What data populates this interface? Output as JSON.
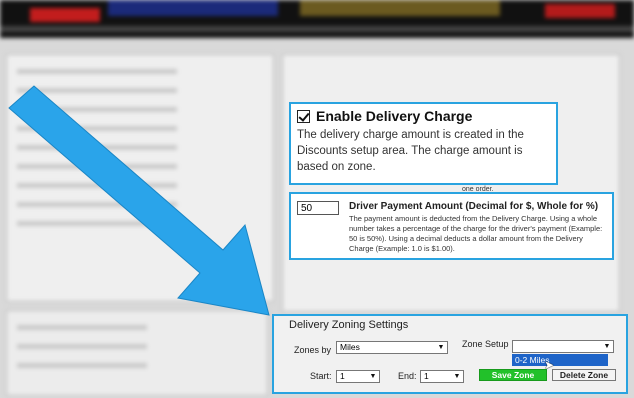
{
  "enable_callout": {
    "title": "Enable Delivery Charge",
    "description": "The delivery charge amount is created in the Discounts setup area. The charge amount is based on zone."
  },
  "driver_callout": {
    "value": "50",
    "label": "Driver Payment Amount (Decimal for $, Whole for %)",
    "description": "The payment amount is deducted from the Delivery Charge. Using a whole number takes a percentage of the charge for the driver's payment (Example: 50 is 50%). Using a decimal deducts a dollar amount from the Delivery Charge (Example: 1.0 is $1.00)."
  },
  "zoning": {
    "title": "Delivery Zoning Settings",
    "zones_by_label": "Zones by",
    "zones_by_value": "Miles",
    "zone_setup_label": "Zone Setup",
    "zone_setup_value": "",
    "zone_setup_option": "0-2 Miles",
    "start_label": "Start:",
    "start_value": "1",
    "end_label": "End:",
    "end_value": "1",
    "save_label": "Save Zone",
    "delete_label": "Delete Zone"
  },
  "background": {
    "tail_text": "one order."
  },
  "colors": {
    "callout_border": "#29a3e0",
    "arrow": "#2aa4ea",
    "save_button": "#22c12a",
    "selected_option": "#1e64c8"
  }
}
